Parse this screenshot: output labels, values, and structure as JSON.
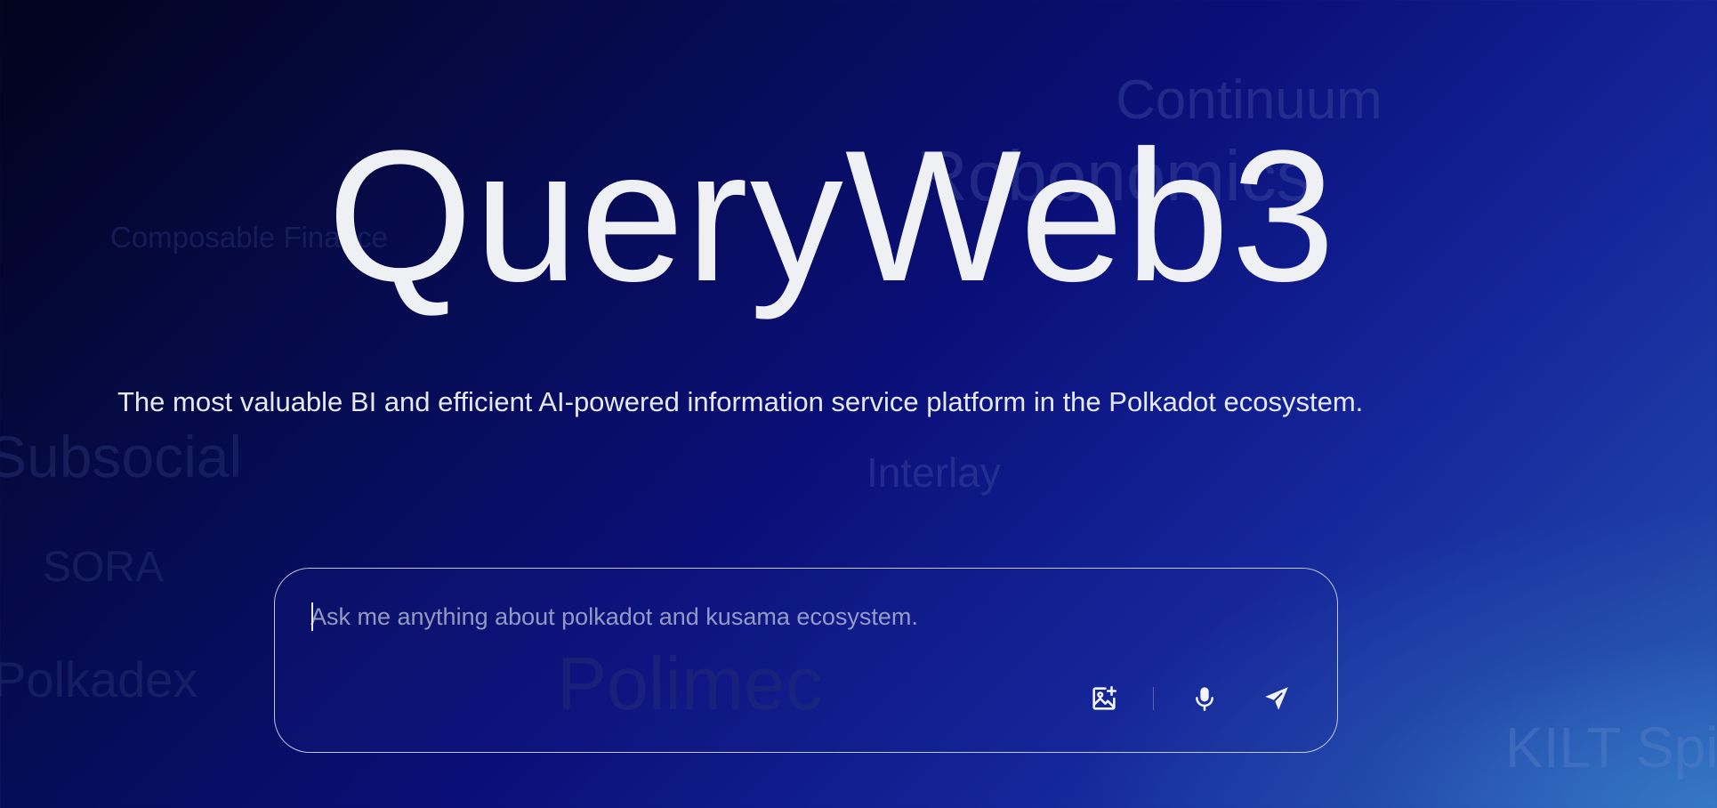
{
  "background_words": {
    "continuum": "Continuum",
    "robonomics": "Robonomics",
    "composable": "Composable Finance",
    "subsocial": "Subsocial",
    "interlay": "Interlay",
    "sora": "SORA",
    "polkadex": "Polkadex",
    "polimec": "Polimec",
    "kilt": "KILT Spiritnet"
  },
  "hero": {
    "title": "QueryWeb3",
    "subtitle": "The most valuable BI and efficient AI-powered information service platform in the Polkadot ecosystem."
  },
  "chat": {
    "placeholder": "Ask me anything about polkadot and kusama ecosystem.",
    "value": "",
    "icons": {
      "image_upload": "image-add-icon",
      "microphone": "microphone-icon",
      "send": "send-icon"
    }
  },
  "colors": {
    "title": "#eef0f4",
    "background_dark": "#02031c",
    "background_mid": "#0a0f78",
    "background_light": "#2a5bb5"
  }
}
